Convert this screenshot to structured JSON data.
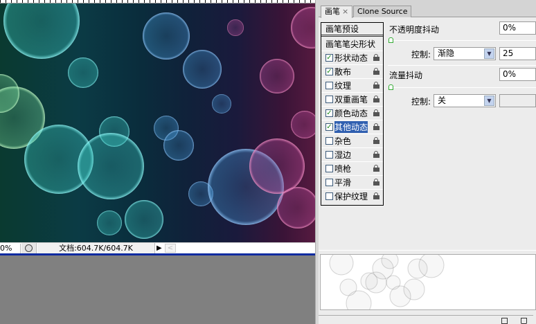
{
  "status": {
    "zoom": "0%",
    "doc": "文档:604.7K/604.7K"
  },
  "panel": {
    "tabs": [
      {
        "label": "画笔",
        "close": "×"
      },
      {
        "label": "Clone Source"
      }
    ],
    "preset": "画笔预设",
    "tip_shape": "画笔笔尖形状",
    "items": [
      {
        "label": "形状动态",
        "checked": true
      },
      {
        "label": "散布",
        "checked": true
      },
      {
        "label": "纹理",
        "checked": false
      },
      {
        "label": "双重画笔",
        "checked": false
      },
      {
        "label": "颜色动态",
        "checked": true
      },
      {
        "label": "其他动态",
        "checked": true,
        "selected": true
      },
      {
        "label": "杂色",
        "checked": false
      },
      {
        "label": "湿边",
        "checked": false
      },
      {
        "label": "喷枪",
        "checked": false
      },
      {
        "label": "平滑",
        "checked": false
      },
      {
        "label": "保护纹理",
        "checked": false
      }
    ],
    "opacity_jitter": {
      "label": "不透明度抖动",
      "value": "0%",
      "control_label": "控制:",
      "control": "渐隐",
      "fade_steps": "25",
      "slider": 0
    },
    "flow_jitter": {
      "label": "流量抖动",
      "value": "0%",
      "control_label": "控制:",
      "control": "关",
      "slider": 0
    },
    "check_mark": "✓"
  }
}
